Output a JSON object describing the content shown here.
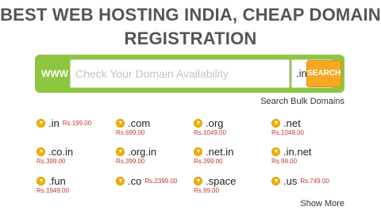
{
  "header": {
    "title_line1": "BEST WEB HOSTING INDIA, CHEAP DOMAIN",
    "title_line2": "REGISTRATION"
  },
  "search": {
    "prefix": "WWW",
    "placeholder": "Check Your Domain Availability",
    "tld_selected": ".in",
    "button_label": "SEARCH",
    "bulk_link": "Search Bulk Domains"
  },
  "domains": [
    {
      "tld": ".in",
      "price": "Rs.199.00"
    },
    {
      "tld": ".com",
      "price": "Rs.699.00"
    },
    {
      "tld": ".org",
      "price": "Rs.1049.00"
    },
    {
      "tld": ".net",
      "price": "Rs.1049.00"
    },
    {
      "tld": ".co.in",
      "price": "Rs.399.00"
    },
    {
      "tld": ".org.in",
      "price": "Rs.399.00"
    },
    {
      "tld": ".net.in",
      "price": "Rs.399.00"
    },
    {
      "tld": ".in.net",
      "price": "Rs.99.00"
    },
    {
      "tld": ".fun",
      "price": "Rs.1949.00"
    },
    {
      "tld": ".co",
      "price": "Rs.2399.00"
    },
    {
      "tld": ".space",
      "price": "Rs.99.00"
    },
    {
      "tld": ".us",
      "price": "Rs.749.00"
    }
  ],
  "footer": {
    "show_more": "Show More"
  },
  "colors": {
    "search_bar_bg": "#8dc63f",
    "search_button_bg": "#f7a823",
    "price_text": "#c0392b",
    "coin_icon": "#f0b400"
  }
}
